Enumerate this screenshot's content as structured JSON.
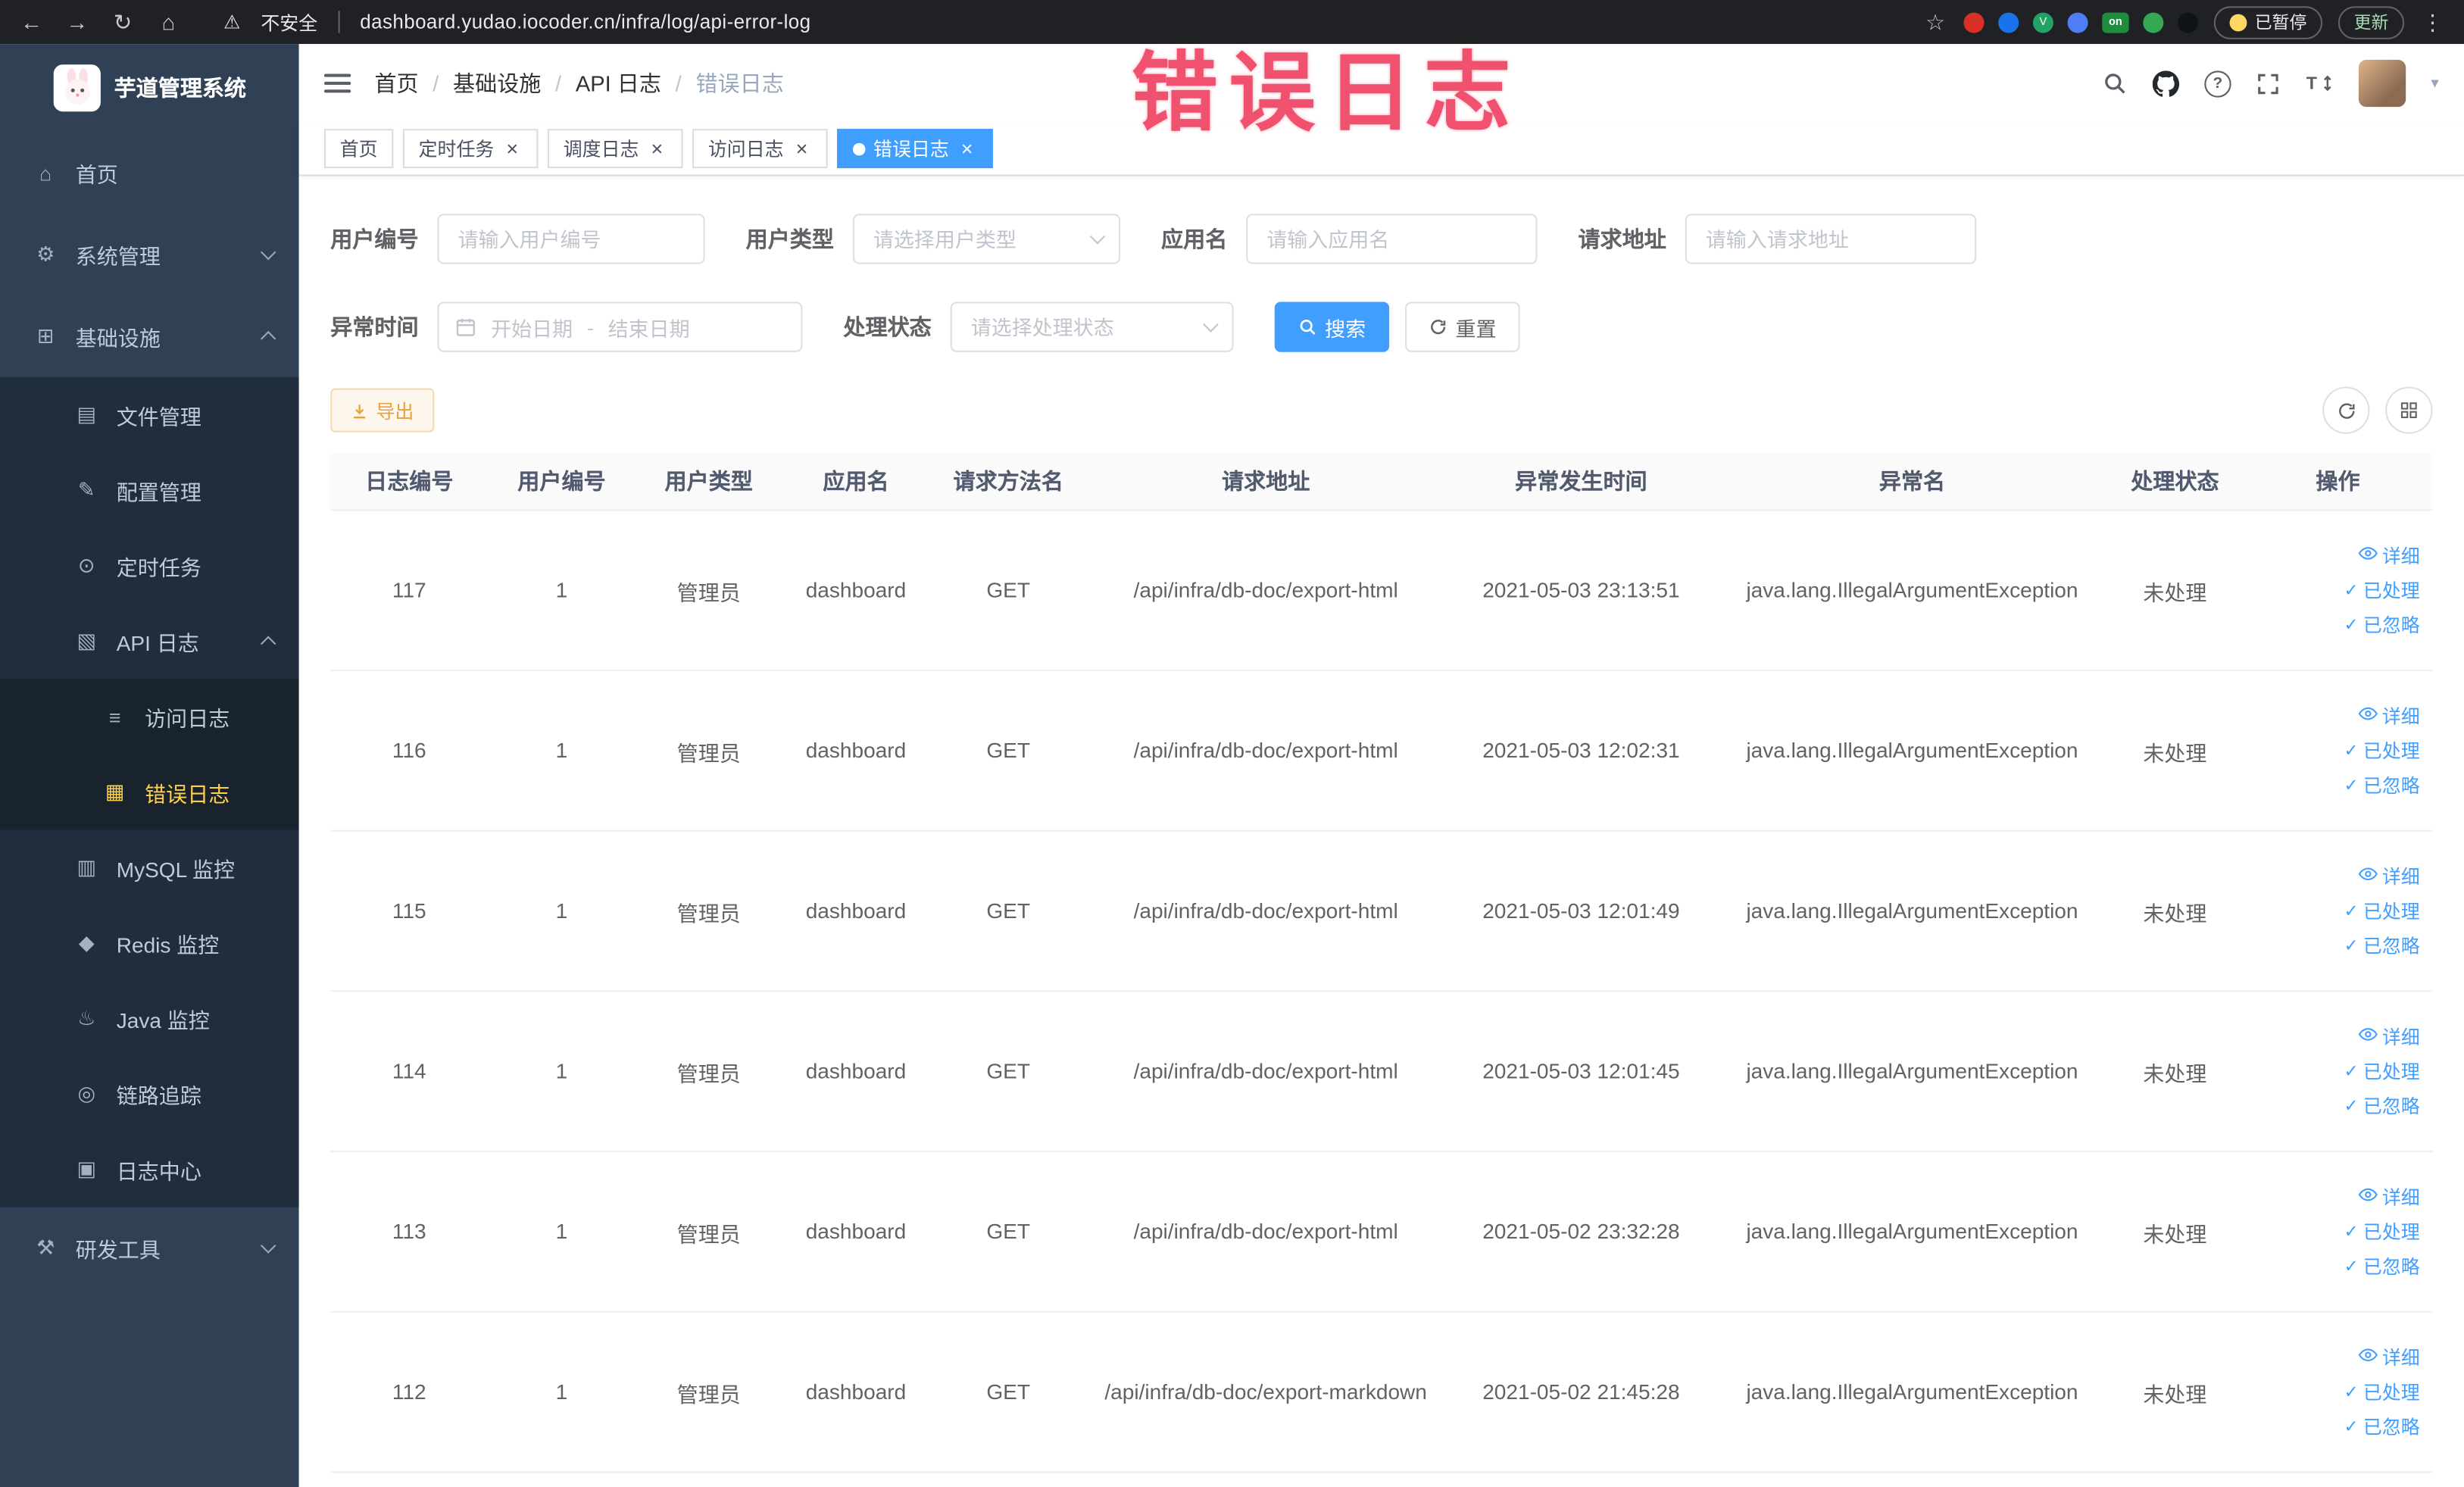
{
  "theme": {
    "primary": "#409eff",
    "warning": "#e6a23c",
    "sidebar_bg": "#304156",
    "submenu_bg": "#1f2d3d",
    "active_menu_color": "#ffd04b",
    "overlay_color": "#f0516e"
  },
  "overlay": {
    "text": "错误日志"
  },
  "browser": {
    "security_label": "不安全",
    "url": "dashboard.yudao.iocoder.cn/infra/log/api-error-log",
    "paused_label": "已暂停",
    "update_label": "更新",
    "extensions": [
      {
        "name": "extension-record-icon",
        "color": "#d93025"
      },
      {
        "name": "extension-drop-icon",
        "color": "#1a73e8"
      },
      {
        "name": "extension-v-icon",
        "color": "#21a366",
        "label": "V"
      },
      {
        "name": "extension-grid-icon",
        "color": "#4f7df3"
      },
      {
        "name": "extension-on-icon",
        "color": "#1e8e3e",
        "label": "on",
        "shape": "badge"
      },
      {
        "name": "extension-leaf-icon",
        "color": "#34a853"
      },
      {
        "name": "extension-bird-icon",
        "color": "#0f1419"
      }
    ]
  },
  "sidebar": {
    "logo_title": "芋道管理系统",
    "items": [
      {
        "key": "home",
        "label": "首页",
        "icon": "home-icon",
        "glyph": "⌂",
        "level": 0
      },
      {
        "key": "system",
        "label": "系统管理",
        "icon": "gear-icon",
        "glyph": "⚙",
        "level": 0,
        "arrow": "down"
      },
      {
        "key": "infra",
        "label": "基础设施",
        "icon": "infra-icon",
        "glyph": "⊞",
        "level": 0,
        "arrow": "up"
      },
      {
        "key": "file",
        "label": "文件管理",
        "icon": "file-icon",
        "glyph": "▤",
        "level": 1
      },
      {
        "key": "config",
        "label": "配置管理",
        "icon": "config-icon",
        "glyph": "✎",
        "level": 1
      },
      {
        "key": "job",
        "label": "定时任务",
        "icon": "timer-icon",
        "glyph": "⊙",
        "level": 1
      },
      {
        "key": "api-log",
        "label": "API 日志",
        "icon": "api-log-icon",
        "glyph": "▧",
        "level": 1,
        "arrow": "up"
      },
      {
        "key": "access-log",
        "label": "访问日志",
        "icon": "access-log-icon",
        "glyph": "≡",
        "level": 2
      },
      {
        "key": "error-log",
        "label": "错误日志",
        "icon": "error-log-icon",
        "glyph": "▦",
        "level": 2,
        "active": true
      },
      {
        "key": "mysql",
        "label": "MySQL 监控",
        "icon": "mysql-icon",
        "glyph": "▥",
        "level": 1
      },
      {
        "key": "redis",
        "label": "Redis 监控",
        "icon": "redis-icon",
        "glyph": "◆",
        "level": 1
      },
      {
        "key": "java",
        "label": "Java 监控",
        "icon": "java-icon",
        "glyph": "♨",
        "level": 1
      },
      {
        "key": "trace",
        "label": "链路追踪",
        "icon": "trace-icon",
        "glyph": "◎",
        "level": 1
      },
      {
        "key": "log-center",
        "label": "日志中心",
        "icon": "log-center-icon",
        "glyph": "▣",
        "level": 1
      },
      {
        "key": "dev-tools",
        "label": "研发工具",
        "icon": "tools-icon",
        "glyph": "⚒",
        "level": 0,
        "arrow": "down"
      }
    ]
  },
  "header": {
    "breadcrumb": [
      "首页",
      "基础设施",
      "API 日志",
      "错误日志"
    ]
  },
  "tabs": [
    {
      "key": "home",
      "label": "首页",
      "closable": false,
      "active": false
    },
    {
      "key": "job",
      "label": "定时任务",
      "closable": true,
      "active": false
    },
    {
      "key": "schedule-log",
      "label": "调度日志",
      "closable": true,
      "active": false
    },
    {
      "key": "access-log",
      "label": "访问日志",
      "closable": true,
      "active": false
    },
    {
      "key": "error-log",
      "label": "错误日志",
      "closable": true,
      "active": true
    }
  ],
  "filters": {
    "user_id": {
      "label": "用户编号",
      "placeholder": "请输入用户编号"
    },
    "user_type": {
      "label": "用户类型",
      "placeholder": "请选择用户类型"
    },
    "app_name": {
      "label": "应用名",
      "placeholder": "请输入应用名"
    },
    "request_url": {
      "label": "请求地址",
      "placeholder": "请输入请求地址"
    },
    "exception_time": {
      "label": "异常时间",
      "start_placeholder": "开始日期",
      "separator": "-",
      "end_placeholder": "结束日期"
    },
    "process_status": {
      "label": "处理状态",
      "placeholder": "请选择处理状态"
    },
    "search_label": "搜索",
    "reset_label": "重置"
  },
  "toolbar": {
    "export_label": "导出"
  },
  "table": {
    "columns": [
      "日志编号",
      "用户编号",
      "用户类型",
      "应用名",
      "请求方法名",
      "请求地址",
      "异常发生时间",
      "异常名",
      "处理状态",
      "操作"
    ],
    "actions": {
      "detail": "详细",
      "processed": "已处理",
      "ignored": "已忽略"
    },
    "rows": [
      {
        "id": "117",
        "user_id": "1",
        "user_type": "管理员",
        "app": "dashboard",
        "method": "GET",
        "url": "/api/infra/db-doc/export-html",
        "time": "2021-05-03 23:13:51",
        "exception": "java.lang.IllegalArgumentException",
        "status": "未处理"
      },
      {
        "id": "116",
        "user_id": "1",
        "user_type": "管理员",
        "app": "dashboard",
        "method": "GET",
        "url": "/api/infra/db-doc/export-html",
        "time": "2021-05-03 12:02:31",
        "exception": "java.lang.IllegalArgumentException",
        "status": "未处理"
      },
      {
        "id": "115",
        "user_id": "1",
        "user_type": "管理员",
        "app": "dashboard",
        "method": "GET",
        "url": "/api/infra/db-doc/export-html",
        "time": "2021-05-03 12:01:49",
        "exception": "java.lang.IllegalArgumentException",
        "status": "未处理"
      },
      {
        "id": "114",
        "user_id": "1",
        "user_type": "管理员",
        "app": "dashboard",
        "method": "GET",
        "url": "/api/infra/db-doc/export-html",
        "time": "2021-05-03 12:01:45",
        "exception": "java.lang.IllegalArgumentException",
        "status": "未处理"
      },
      {
        "id": "113",
        "user_id": "1",
        "user_type": "管理员",
        "app": "dashboard",
        "method": "GET",
        "url": "/api/infra/db-doc/export-html",
        "time": "2021-05-02 23:32:28",
        "exception": "java.lang.IllegalArgumentException",
        "status": "未处理"
      },
      {
        "id": "112",
        "user_id": "1",
        "user_type": "管理员",
        "app": "dashboard",
        "method": "GET",
        "url": "/api/infra/db-doc/export-markdown",
        "time": "2021-05-02 21:45:28",
        "exception": "java.lang.IllegalArgumentException",
        "status": "未处理"
      }
    ]
  }
}
